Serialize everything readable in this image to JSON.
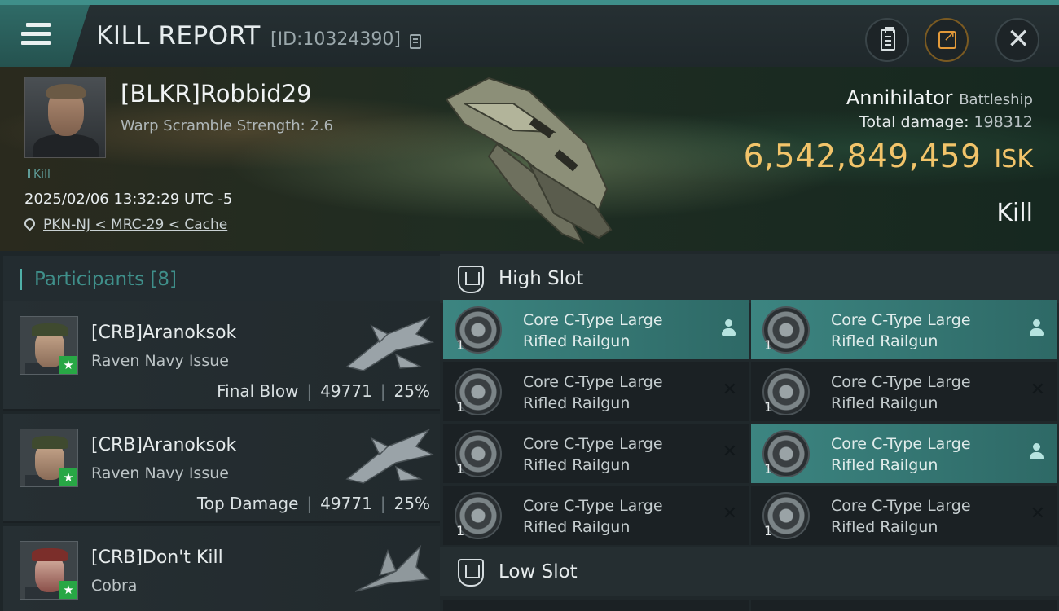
{
  "header": {
    "title": "KILL REPORT",
    "report_id": "[ID:10324390]"
  },
  "victim": {
    "pilot": "[BLKR]Robbid29",
    "warp_scramble": "Warp Scramble Strength: 2.6",
    "tag": "Kill",
    "datetime": "2025/02/06 13:32:29 UTC -5",
    "location": "PKN-NJ < MRC-29 < Cache",
    "ship_name": "Annihilator",
    "ship_class": "Battleship",
    "damage_label": "Total damage:",
    "damage_value": "198312",
    "isk_value": "6,542,849,459",
    "isk_unit": "ISK",
    "result": "Kill"
  },
  "participants": {
    "title": "Participants [8]",
    "rows": [
      {
        "name": "[CRB]Aranoksok",
        "ship": "Raven Navy Issue",
        "role": "Final Blow",
        "damage": "49771",
        "percent": "25%"
      },
      {
        "name": "[CRB]Aranoksok",
        "ship": "Raven Navy Issue",
        "role": "Top Damage",
        "damage": "49771",
        "percent": "25%"
      },
      {
        "name": "[CRB]Don't Kill",
        "ship": "Cobra"
      }
    ]
  },
  "slots": {
    "high": {
      "label": "High Slot",
      "items": [
        {
          "qty": "1",
          "line1": "Core C-Type Large",
          "line2": "Rifled Railgun",
          "status": "dropped"
        },
        {
          "qty": "1",
          "line1": "Core C-Type Large",
          "line2": "Rifled Railgun",
          "status": "dropped"
        },
        {
          "qty": "1",
          "line1": "Core C-Type Large",
          "line2": "Rifled Railgun",
          "status": "destroyed"
        },
        {
          "qty": "1",
          "line1": "Core C-Type Large",
          "line2": "Rifled Railgun",
          "status": "destroyed"
        },
        {
          "qty": "1",
          "line1": "Core C-Type Large",
          "line2": "Rifled Railgun",
          "status": "destroyed"
        },
        {
          "qty": "1",
          "line1": "Core C-Type Large",
          "line2": "Rifled Railgun",
          "status": "dropped"
        },
        {
          "qty": "1",
          "line1": "Core C-Type Large",
          "line2": "Rifled Railgun",
          "status": "destroyed"
        },
        {
          "qty": "1",
          "line1": "Core C-Type Large",
          "line2": "Rifled Railgun",
          "status": "destroyed"
        }
      ]
    },
    "low": {
      "label": "Low Slot"
    }
  },
  "colors": {
    "accent": "#3f8f8a",
    "isk": "#f2c46a",
    "active_item": "#3c8581",
    "star": "#28a745"
  },
  "icons": [
    "menu-icon",
    "copy-icon",
    "clipboard-icon",
    "share-icon",
    "close-icon",
    "location-pin-icon",
    "shield-icon",
    "person-icon",
    "cross-icon",
    "star-icon"
  ]
}
